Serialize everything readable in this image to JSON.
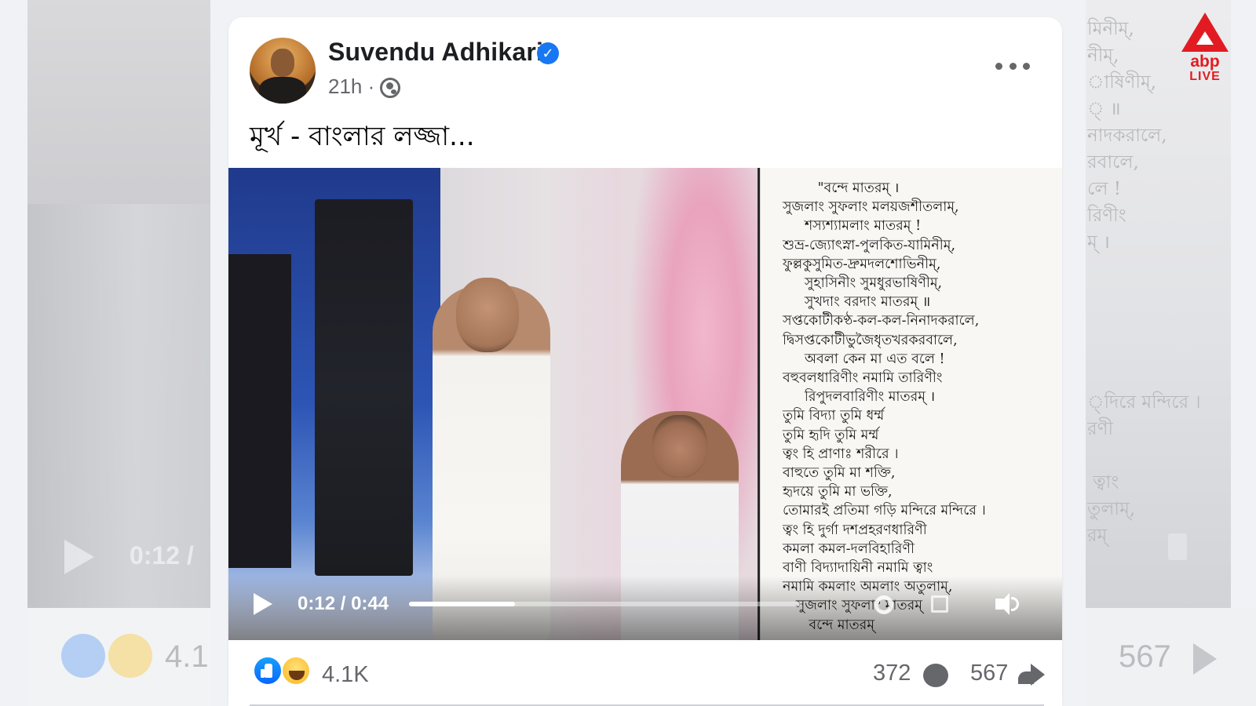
{
  "post": {
    "author_name": "Suvendu Adhikari",
    "verified_mark": "✓",
    "timestamp": "21h ·",
    "caption": "মূর্খ - বাংলার লজ্জা..."
  },
  "video": {
    "current_time": "0:12",
    "separator": " / ",
    "duration": "0:44",
    "progress_fraction": 0.27,
    "poem_lines": [
      "        \"বন্দে মাতরম্‌ ।",
      "সুজলাং সুফলাং মলয়জশীতলাম্‌,",
      "     শস্যশ্যামলাং মাতরম্‌ !",
      "শুভ্র-জ্যোৎস্না-পুলকিত-যামিনীম্‌,",
      "ফুল্লকুসুমিত-দ্রুমদলশোভিনীম্‌,",
      "     সুহাসিনীং সুমধুরভাষিণীম্‌,",
      "     সুখদাং বরদাং মাতরম্‌ ॥",
      "সপ্তকোটীকণ্ঠ-কল-কল-নিনাদকরালে,",
      "দ্বিসপ্তকোটীভুজৈধৃতখরকরবালে,",
      "     অবলা কেন মা এত বলে !",
      "বহুবলধারিণীং নমামি তারিণীং",
      "     রিপুদলবারিণীং মাতরম্‌ ।",
      "তুমি বিদ্যা তুমি ধর্ম্ম",
      "তুমি হৃদি তুমি মর্ম্ম",
      "ত্বং হি প্রাণাঃ শরীরে ।",
      "বাহুতে তুমি মা শক্তি,",
      "হৃদয়ে তুমি মা ভক্তি,",
      "তোমারই প্রতিমা গড়ি মন্দিরে মন্দিরে ।",
      "ত্বং হি দুর্গা দশপ্রহরণধারিণী",
      "কমলা কমল-দলবিহারিণী",
      "বাণী বিদ্যাদায়িনী নমামি ত্বাং",
      "নমামি কমলাং অমলাং অতুলাম্‌,",
      "   সুজলাং সুফলাং মাতরম্‌",
      "      বন্দে মাতরম্‌"
    ]
  },
  "reactions": {
    "count": "4.1K",
    "comments_count": "372",
    "shares_count": "567",
    "icons": [
      "like-icon",
      "haha-icon",
      "comment-icon",
      "share-icon",
      "globe-icon",
      "play-icon",
      "settings-icon",
      "fullscreen-icon",
      "volume-icon"
    ]
  },
  "background": {
    "left_time": "0:12 /",
    "left_count": "4.1",
    "right_count": "567",
    "right_text": "মিনীম্‌,\nনীম্‌,\nাষিণীম্‌,\n্‌ ॥\nনাদকরালে,\nরবালে,\nলে !\nরিণীং\nম্‌ ।\n\n\n\n\n\n্দিরে মন্দিরে ।\nরণী\n\n ত্বাং\nতুলাম্‌,\nরম্‌"
  },
  "watermark": {
    "brand": "abp",
    "tag": "LIVE"
  },
  "colors": {
    "verified_blue": "#1877f2",
    "abp_red": "#e21b22",
    "secondary_text": "#65676b"
  }
}
